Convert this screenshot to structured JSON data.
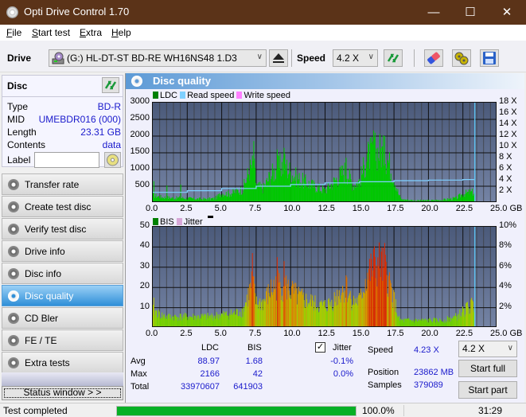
{
  "window": {
    "title": "Opti Drive Control 1.70",
    "controls": {
      "minimize": "—",
      "maximize": "☐",
      "close": "✕"
    }
  },
  "menu": [
    {
      "label": "File",
      "accel": "F",
      "rest": "ile"
    },
    {
      "label": "Start test",
      "accel": "S",
      "rest": "tart test"
    },
    {
      "label": "Extra",
      "accel": "E",
      "rest": "xtra"
    },
    {
      "label": "Help",
      "accel": "H",
      "rest": "elp"
    }
  ],
  "toolbar": {
    "drive_label": "Drive",
    "drive_value": "(G:)  HL-DT-ST BD-RE  WH16NS48 1.D3",
    "speed_label": "Speed",
    "speed_value": "4.2 X",
    "icons": [
      "eject-icon",
      "refresh-icon",
      "erase-icon",
      "settings-icon",
      "save-icon"
    ]
  },
  "disc": {
    "header": "Disc",
    "rows": [
      {
        "key": "Type",
        "value": "BD-R"
      },
      {
        "key": "MID",
        "value": "UMEBDR016 (000)"
      },
      {
        "key": "Length",
        "value": "23.31 GB"
      },
      {
        "key": "Contents",
        "value": "data"
      }
    ],
    "label_key": "Label",
    "label_value": ""
  },
  "nav": [
    {
      "label": "Transfer rate",
      "active": false
    },
    {
      "label": "Create test disc",
      "active": false
    },
    {
      "label": "Verify test disc",
      "active": false
    },
    {
      "label": "Drive info",
      "active": false
    },
    {
      "label": "Disc info",
      "active": false
    },
    {
      "label": "Disc quality",
      "active": true
    },
    {
      "label": "CD Bler",
      "active": false
    },
    {
      "label": "FE / TE",
      "active": false
    },
    {
      "label": "Extra tests",
      "active": false
    }
  ],
  "status_window_label": "Status window > >",
  "main": {
    "title": "Disc quality"
  },
  "chart_data": [
    {
      "type": "area",
      "title": "LDC / Read speed",
      "legend": [
        {
          "label": "LDC",
          "color": "#008000"
        },
        {
          "label": "Read speed",
          "color": "#7fd0ff"
        },
        {
          "label": "Write speed",
          "color": "#ff80ff"
        }
      ],
      "xlabel": "GB",
      "x_ticks": [
        "0.0",
        "2.5",
        "5.0",
        "7.5",
        "10.0",
        "12.5",
        "15.0",
        "17.5",
        "20.0",
        "22.5",
        "25.0 GB"
      ],
      "xlim": [
        0,
        25
      ],
      "y_ticks": [
        "3000",
        "2500",
        "2000",
        "1500",
        "1000",
        "500"
      ],
      "ylim": [
        0,
        3000
      ],
      "y2_ticks": [
        "18 X",
        "16 X",
        "14 X",
        "12 X",
        "10 X",
        "8 X",
        "6 X",
        "4 X",
        "2 X"
      ],
      "y2lim": [
        0,
        18
      ],
      "grid": true,
      "end_marker_gb": 23.31,
      "ldc_envelope": [
        [
          0.0,
          250
        ],
        [
          0.5,
          200
        ],
        [
          1.0,
          180
        ],
        [
          1.5,
          160
        ],
        [
          2.0,
          170
        ],
        [
          2.5,
          150
        ],
        [
          3.0,
          140
        ],
        [
          3.5,
          130
        ],
        [
          4.0,
          130
        ],
        [
          4.5,
          150
        ],
        [
          5.0,
          330
        ],
        [
          5.5,
          300
        ],
        [
          6.0,
          380
        ],
        [
          6.5,
          450
        ],
        [
          7.0,
          1100
        ],
        [
          7.3,
          1300
        ],
        [
          7.5,
          550
        ],
        [
          8.0,
          500
        ],
        [
          8.5,
          900
        ],
        [
          9.0,
          1150
        ],
        [
          9.5,
          1300
        ],
        [
          10.0,
          1000
        ],
        [
          10.5,
          800
        ],
        [
          11.0,
          700
        ],
        [
          11.5,
          600
        ],
        [
          12.0,
          500
        ],
        [
          12.5,
          420
        ],
        [
          13.0,
          650
        ],
        [
          13.5,
          900
        ],
        [
          14.0,
          1100
        ],
        [
          14.5,
          600
        ],
        [
          15.0,
          750
        ],
        [
          15.5,
          1500
        ],
        [
          16.0,
          1700
        ],
        [
          16.5,
          1750
        ],
        [
          17.0,
          1500
        ],
        [
          17.5,
          800
        ],
        [
          17.8,
          300
        ],
        [
          18.0,
          120
        ],
        [
          19.0,
          80
        ],
        [
          20.0,
          80
        ],
        [
          21.0,
          100
        ],
        [
          22.0,
          160
        ],
        [
          22.5,
          300
        ],
        [
          23.0,
          350
        ],
        [
          23.31,
          350
        ]
      ],
      "ldc_peaks": [
        [
          0.05,
          650
        ],
        [
          1.0,
          520
        ],
        [
          2.0,
          550
        ],
        [
          7.3,
          1850
        ],
        [
          9.0,
          1600
        ],
        [
          9.5,
          1650
        ],
        [
          14.0,
          1350
        ],
        [
          16.0,
          2166
        ],
        [
          16.8,
          2000
        ]
      ],
      "read_speed": [
        [
          0.0,
          1.9
        ],
        [
          2.5,
          2.2
        ],
        [
          5.0,
          2.6
        ],
        [
          7.5,
          3.0
        ],
        [
          10.0,
          3.3
        ],
        [
          12.5,
          3.6
        ],
        [
          15.0,
          3.8
        ],
        [
          17.5,
          4.0
        ],
        [
          20.0,
          4.1
        ],
        [
          22.5,
          4.2
        ],
        [
          23.31,
          4.23
        ]
      ]
    },
    {
      "type": "bar",
      "title": "BIS / Jitter",
      "legend": [
        {
          "label": "BIS",
          "color": "#008000"
        },
        {
          "label": "Jitter",
          "color": "#d8a8d8"
        }
      ],
      "xlabel": "GB",
      "x_ticks": [
        "0.0",
        "2.5",
        "5.0",
        "7.5",
        "10.0",
        "12.5",
        "15.0",
        "17.5",
        "20.0",
        "22.5",
        "25.0 GB"
      ],
      "xlim": [
        0,
        25
      ],
      "y_ticks": [
        "50",
        "40",
        "30",
        "20",
        "10"
      ],
      "ylim": [
        0,
        50
      ],
      "y2_ticks": [
        "10%",
        "8%",
        "6%",
        "4%",
        "2%"
      ],
      "y2lim": [
        0,
        10
      ],
      "grid": true,
      "end_marker_gb": 23.31,
      "bis_envelope": [
        [
          0.0,
          10
        ],
        [
          0.5,
          7
        ],
        [
          1.0,
          6
        ],
        [
          2.0,
          6
        ],
        [
          3.0,
          6
        ],
        [
          4.0,
          6
        ],
        [
          5.0,
          7
        ],
        [
          6.0,
          8
        ],
        [
          6.5,
          9
        ],
        [
          7.0,
          20
        ],
        [
          7.2,
          25
        ],
        [
          7.5,
          13
        ],
        [
          8.0,
          14
        ],
        [
          8.5,
          20
        ],
        [
          9.0,
          24
        ],
        [
          9.5,
          23
        ],
        [
          10.0,
          20
        ],
        [
          10.5,
          17
        ],
        [
          11.0,
          15
        ],
        [
          11.5,
          14
        ],
        [
          12.0,
          12
        ],
        [
          12.5,
          12
        ],
        [
          13.0,
          14
        ],
        [
          13.5,
          19
        ],
        [
          14.0,
          22
        ],
        [
          14.5,
          14
        ],
        [
          15.0,
          15
        ],
        [
          15.5,
          28
        ],
        [
          16.0,
          33
        ],
        [
          16.5,
          35
        ],
        [
          17.0,
          28
        ],
        [
          17.5,
          15
        ],
        [
          17.8,
          5
        ],
        [
          18.0,
          4
        ],
        [
          19.0,
          4
        ],
        [
          20.0,
          4
        ],
        [
          21.0,
          4
        ],
        [
          22.0,
          6
        ],
        [
          22.5,
          9
        ],
        [
          23.0,
          12
        ],
        [
          23.31,
          12
        ]
      ],
      "bis_peaks": [
        [
          0.05,
          15
        ],
        [
          7.2,
          37
        ],
        [
          9.0,
          35
        ],
        [
          9.5,
          33
        ],
        [
          14.0,
          26
        ],
        [
          16.0,
          39
        ],
        [
          16.8,
          42
        ]
      ],
      "jitter_pct": -0.1
    }
  ],
  "stats": {
    "col_ldc": "LDC",
    "col_bis": "BIS",
    "jitter_label": "Jitter",
    "jitter_checked": true,
    "rows": [
      {
        "label": "Avg",
        "ldc": "88.97",
        "bis": "1.68",
        "jitter": "-0.1%"
      },
      {
        "label": "Max",
        "ldc": "2166",
        "bis": "42",
        "jitter": "0.0%"
      },
      {
        "label": "Total",
        "ldc": "33970607",
        "bis": "641903",
        "jitter": ""
      }
    ],
    "speed_label": "Speed",
    "speed_value": "4.23 X",
    "position_label": "Position",
    "position_value": "23862 MB",
    "samples_label": "Samples",
    "samples_value": "379089",
    "speed_select": "4.2 X",
    "start_full": "Start full",
    "start_part": "Start part"
  },
  "statusbar": {
    "text": "Test completed",
    "progress_pct": 100.0,
    "progress_label": "100.0%",
    "time": "31:29"
  }
}
